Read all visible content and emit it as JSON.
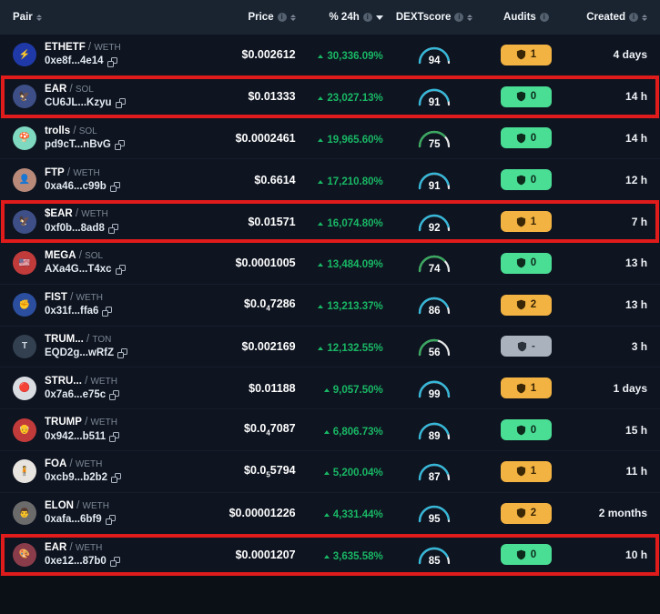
{
  "header": {
    "columns": [
      {
        "label": "Pair",
        "info": false,
        "sortable": true
      },
      {
        "label": "Price",
        "info": true,
        "sortable": true
      },
      {
        "label": "% 24h",
        "info": true,
        "sortable": true,
        "active_desc": true
      },
      {
        "label": "DEXTscore",
        "info": true,
        "sortable": true
      },
      {
        "label": "Audits",
        "info": true,
        "sortable": false
      },
      {
        "label": "Created",
        "info": true,
        "sortable": true
      }
    ]
  },
  "colors": {
    "page_background": "#0b1017",
    "header_background": "#1a2431",
    "row_background": "#0e1420",
    "row_divider": "#161d2b",
    "positive_change": "#19b865",
    "highlight_border": "#e01b1b",
    "gauge_high": "#35b7d8",
    "gauge_mid": "#3aa85f",
    "gauge_track": "#ffffff",
    "badge_green": "#4ade95",
    "badge_orange": "#f3b342",
    "badge_gray": "#aab3bd"
  },
  "rows": [
    {
      "base": "ETHETF",
      "quote": "WETH",
      "address": "0xe8f...4e14",
      "avatar_bg": "#1f3aa8",
      "avatar_text": "⚡",
      "price": "$0.002612",
      "price_prefix": "",
      "price_sub": "",
      "price_suffix": "",
      "change": "30,336.09%",
      "score": 94,
      "score_color": "high",
      "audit_count": "1",
      "audit_color": "orange",
      "created": "4 days",
      "highlighted": false
    },
    {
      "base": "EAR",
      "quote": "SOL",
      "address": "CU6JL...Kzyu",
      "avatar_bg": "#3d4f86",
      "avatar_text": "🦅",
      "price": "$0.01333",
      "price_prefix": "",
      "price_sub": "",
      "price_suffix": "",
      "change": "23,027.13%",
      "score": 91,
      "score_color": "high",
      "audit_count": "0",
      "audit_color": "green",
      "created": "14 h",
      "highlighted": true
    },
    {
      "base": "trolls",
      "quote": "SOL",
      "address": "pd9cT...nBvG",
      "avatar_bg": "#7fd9c0",
      "avatar_text": "🍄",
      "price": "$0.0002461",
      "price_prefix": "",
      "price_sub": "",
      "price_suffix": "",
      "change": "19,965.60%",
      "score": 75,
      "score_color": "mid",
      "audit_count": "0",
      "audit_color": "green",
      "created": "14 h",
      "highlighted": false
    },
    {
      "base": "FTP",
      "quote": "WETH",
      "address": "0xa46...c99b",
      "avatar_bg": "#b98a7a",
      "avatar_text": "👤",
      "price": "$0.6614",
      "price_prefix": "",
      "price_sub": "",
      "price_suffix": "",
      "change": "17,210.80%",
      "score": 91,
      "score_color": "high",
      "audit_count": "0",
      "audit_color": "cyan",
      "created": "12 h",
      "highlighted": false
    },
    {
      "base": "$EAR",
      "quote": "WETH",
      "address": "0xf0b...8ad8",
      "avatar_bg": "#3d4f86",
      "avatar_text": "🦅",
      "price": "$0.01571",
      "price_prefix": "",
      "price_sub": "",
      "price_suffix": "",
      "change": "16,074.80%",
      "score": 92,
      "score_color": "high",
      "audit_count": "1",
      "audit_color": "orange",
      "created": "7 h",
      "highlighted": true
    },
    {
      "base": "MEGA",
      "quote": "SOL",
      "address": "AXa4G...T4xc",
      "avatar_bg": "#c23b3b",
      "avatar_text": "🇺🇸",
      "price": "$0.0001005",
      "price_prefix": "",
      "price_sub": "",
      "price_suffix": "",
      "change": "13,484.09%",
      "score": 74,
      "score_color": "mid",
      "audit_count": "0",
      "audit_color": "green",
      "created": "13 h",
      "highlighted": false
    },
    {
      "base": "FIST",
      "quote": "WETH",
      "address": "0x31f...ffa6",
      "avatar_bg": "#2b4f9e",
      "avatar_text": "✊",
      "price_prefix": "$0.0",
      "price_sub": "4",
      "price_suffix": "7286",
      "price": "",
      "change": "13,213.37%",
      "score": 86,
      "score_color": "high",
      "audit_count": "2",
      "audit_color": "orange",
      "created": "13 h",
      "highlighted": false
    },
    {
      "base": "TRUM...",
      "quote": "TON",
      "address": "EQD2g...wRfZ",
      "avatar_bg": "#33404f",
      "avatar_text": "T",
      "price": "$0.002169",
      "price_prefix": "",
      "price_sub": "",
      "price_suffix": "",
      "change": "12,132.55%",
      "score": 56,
      "score_color": "mid",
      "audit_count": "-",
      "audit_color": "gray",
      "created": "3 h",
      "highlighted": false
    },
    {
      "base": "STRU...",
      "quote": "WETH",
      "address": "0x7a6...e75c",
      "avatar_bg": "#d9dde2",
      "avatar_text": "🔴",
      "price": "$0.01188",
      "price_prefix": "",
      "price_sub": "",
      "price_suffix": "",
      "change": "9,057.50%",
      "score": 99,
      "score_color": "high",
      "audit_count": "1",
      "audit_color": "orange",
      "created": "1 days",
      "highlighted": false
    },
    {
      "base": "TRUMP",
      "quote": "WETH",
      "address": "0x942...b511",
      "avatar_bg": "#c23b3b",
      "avatar_text": "👴",
      "price_prefix": "$0.0",
      "price_sub": "4",
      "price_suffix": "7087",
      "price": "",
      "change": "6,806.73%",
      "score": 89,
      "score_color": "high",
      "audit_count": "0",
      "audit_color": "green",
      "created": "15 h",
      "highlighted": false
    },
    {
      "base": "FOA",
      "quote": "WETH",
      "address": "0xcb9...b2b2",
      "avatar_bg": "#e8e4df",
      "avatar_text": "🧍",
      "price_prefix": "$0.0",
      "price_sub": "5",
      "price_suffix": "5794",
      "price": "",
      "change": "5,200.04%",
      "score": 87,
      "score_color": "high",
      "audit_count": "1",
      "audit_color": "orange",
      "created": "11 h",
      "highlighted": false
    },
    {
      "base": "ELON",
      "quote": "WETH",
      "address": "0xafa...6bf9",
      "avatar_bg": "#6b6b6b",
      "avatar_text": "👨",
      "price": "$0.00001226",
      "price_prefix": "",
      "price_sub": "",
      "price_suffix": "",
      "change": "4,331.44%",
      "score": 95,
      "score_color": "high",
      "audit_count": "2",
      "audit_color": "orange",
      "created": "2 months",
      "highlighted": false
    },
    {
      "base": "EAR",
      "quote": "WETH",
      "address": "0xe12...87b0",
      "avatar_bg": "#8a3c4a",
      "avatar_text": "🎨",
      "price": "$0.0001207",
      "price_prefix": "",
      "price_sub": "",
      "price_suffix": "",
      "change": "3,635.58%",
      "score": 85,
      "score_color": "high",
      "audit_count": "0",
      "audit_color": "green",
      "created": "10 h",
      "highlighted": true
    }
  ]
}
